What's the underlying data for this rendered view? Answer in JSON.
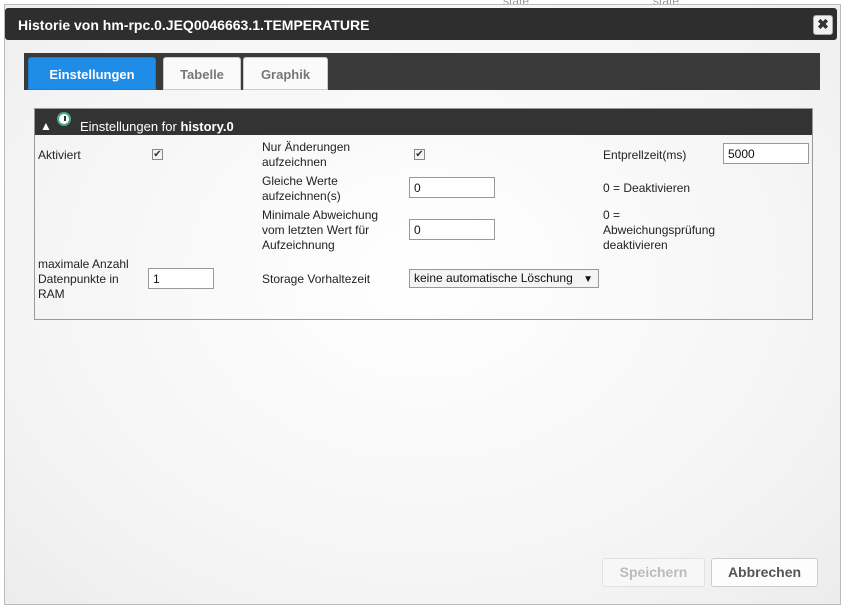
{
  "background": {
    "state_1": "state",
    "state_2": "state"
  },
  "dialog": {
    "title": "Historie von hm-rpc.0.JEQ0046663.1.TEMPERATURE",
    "close_label": "✖"
  },
  "tabs": [
    {
      "label": "Einstellungen",
      "active": true
    },
    {
      "label": "Tabelle",
      "active": false
    },
    {
      "label": "Graphik",
      "active": false
    }
  ],
  "panel": {
    "toggle_symbol": "▲",
    "header_prefix": "Einstellungen for ",
    "header_instance": "history.0",
    "aktiviert_label": "Aktiviert",
    "aktiviert_checked": true,
    "nur_aenderungen_label": "Nur Änderungen aufzeichnen",
    "nur_aenderungen_checked": true,
    "entprellzeit_label": "Entprellzeit(ms)",
    "entprellzeit_value": "5000",
    "gleiche_werte_label": "Gleiche Werte aufzeichnen(s)",
    "gleiche_werte_value": "0",
    "gleiche_werte_hint": "0 = Deaktivieren",
    "min_abweichung_label": "Minimale Abweichung vom letzten Wert für Aufzeichnung",
    "min_abweichung_value": "0",
    "min_abweichung_hint": "0 = Abweichungsprüfung deaktivieren",
    "max_datenpunkte_label": "maximale Anzahl Datenpunkte in RAM",
    "max_datenpunkte_value": "1",
    "storage_label": "Storage Vorhaltezeit",
    "storage_value": "keine automatische Löschung"
  },
  "buttons": {
    "save": "Speichern",
    "cancel": "Abbrechen"
  },
  "colors": {
    "tab_active": "#1f8ce8",
    "title_bar": "#2e2e2e"
  }
}
